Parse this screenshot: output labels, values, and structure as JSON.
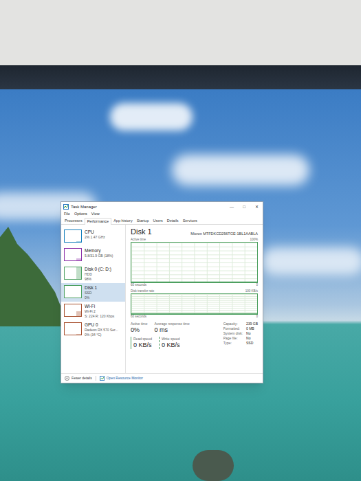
{
  "window": {
    "title": "Task Manager",
    "controls": [
      "—",
      "□",
      "✕"
    ]
  },
  "menu": [
    "File",
    "Options",
    "View"
  ],
  "tabs": [
    {
      "label": "Processes",
      "selected": false
    },
    {
      "label": "Performance",
      "selected": true
    },
    {
      "label": "App history",
      "selected": false
    },
    {
      "label": "Startup",
      "selected": false
    },
    {
      "label": "Users",
      "selected": false
    },
    {
      "label": "Details",
      "selected": false
    },
    {
      "label": "Services",
      "selected": false
    }
  ],
  "sidebar": {
    "items": [
      {
        "name": "CPU",
        "lines": [
          "2% 1.47 GHz"
        ],
        "color": "#117dbb",
        "level": 0.05,
        "selected": false
      },
      {
        "name": "Memory",
        "lines": [
          "5.8/31.9 GB (18%)"
        ],
        "color": "#8b2fa8",
        "level": 0.18,
        "selected": false
      },
      {
        "name": "Disk 0 (C: D:)",
        "lines": [
          "HDD",
          "98%"
        ],
        "color": "#4da060",
        "level": 0.98,
        "selected": false
      },
      {
        "name": "Disk 1",
        "lines": [
          "SSD",
          "0%"
        ],
        "color": "#4da060",
        "level": 0,
        "selected": true
      },
      {
        "name": "Wi-Fi",
        "lines": [
          "Wi-Fi 2",
          "S: 224 R: 120 Kbps"
        ],
        "color": "#a74f2d",
        "level": 0.4,
        "selected": false
      },
      {
        "name": "GPU 0",
        "lines": [
          "Radeon RX 570 Ser...",
          "0% (34 °C)"
        ],
        "color": "#a74f2d",
        "level": 0.05,
        "selected": false
      }
    ]
  },
  "detail": {
    "title": "Disk 1",
    "model": "Micron MTFDKCD256TGE-1BL1AABLA",
    "charts": [
      {
        "label": "Active time",
        "max": "100%",
        "span": "60 seconds",
        "min": "0",
        "series": [
          {
            "values": [
              0,
              0,
              0,
              0,
              0,
              0,
              0,
              0,
              0,
              0,
              0,
              0
            ],
            "dashed": false
          }
        ]
      },
      {
        "label": "Disk transfer rate",
        "max": "100 KB/s",
        "span": "60 seconds",
        "min": "0",
        "series": [
          {
            "values": [
              0,
              0,
              0,
              0,
              0,
              0,
              0,
              0,
              0,
              0,
              0,
              0
            ],
            "dashed": false
          },
          {
            "values": [
              0,
              0,
              0,
              0,
              0,
              0,
              0,
              0,
              0,
              0,
              0,
              0
            ],
            "dashed": true
          }
        ]
      }
    ],
    "stats": [
      {
        "label": "Active time",
        "value": "0%"
      },
      {
        "label": "Average response time",
        "value": "0 ms"
      }
    ],
    "speeds": [
      {
        "label": "Read speed",
        "value": "0 KB/s",
        "dashed": false
      },
      {
        "label": "Write speed",
        "value": "0 KB/s",
        "dashed": true
      }
    ],
    "properties": [
      {
        "label": "Capacity:",
        "value": "239 GB"
      },
      {
        "label": "Formatted:",
        "value": "0 MB"
      },
      {
        "label": "System disk:",
        "value": "No"
      },
      {
        "label": "Page file:",
        "value": "No"
      },
      {
        "label": "Type:",
        "value": "SSD"
      }
    ]
  },
  "footer": {
    "fewer": "Fewer details",
    "monitor": "Open Resource Monitor"
  }
}
